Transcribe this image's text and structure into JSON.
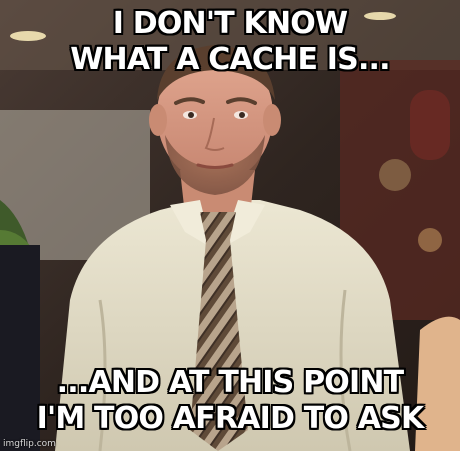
{
  "meme": {
    "top_text": [
      "I DON'T KNOW",
      "WHAT A CACHE IS..."
    ],
    "bottom_text": [
      "...AND AT THIS POINT",
      "I'M TOO AFRAID TO ASK"
    ],
    "watermark": "imgflip.com"
  },
  "colors": {
    "shirt": "#e4dfc9",
    "tie_dark": "#5f4a38",
    "tie_light": "#b8a48c",
    "skin": "#d79a82",
    "hair": "#5a3f2e",
    "background_wall": "#3b2a22",
    "caption_fill": "#ffffff",
    "caption_outline": "#000000"
  }
}
